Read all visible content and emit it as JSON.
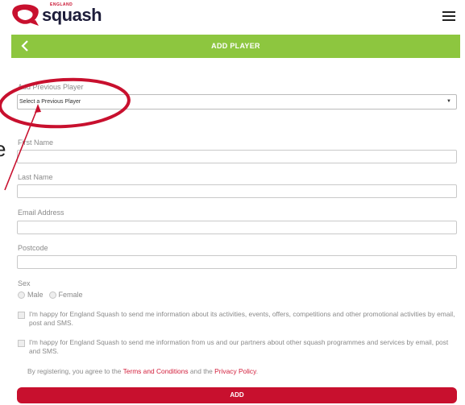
{
  "brand": {
    "name": "squash",
    "tagline": "ENGLAND"
  },
  "title_bar": {
    "label": "ADD PLAYER"
  },
  "form": {
    "previous_player": {
      "label": "Add Previous Player",
      "selected": "Select a Previous Player"
    },
    "first_name": {
      "label": "First Name"
    },
    "last_name": {
      "label": "Last Name"
    },
    "email": {
      "label": "Email Address"
    },
    "postcode": {
      "label": "Postcode"
    },
    "sex": {
      "label": "Sex",
      "options": [
        "Male",
        "Female"
      ]
    },
    "consent_1": "I'm happy for England Squash to send me information about its activities, events, offers, competitions and other promotional activities by email, post and SMS.",
    "consent_2": "I'm happy for England Squash to send me information from us and our partners about other squash programmes and services by email, post and SMS.",
    "legal": {
      "prefix": "By registering, you agree to the ",
      "terms": "Terms and Conditions",
      "middle": " and the ",
      "privacy": "Privacy Policy",
      "suffix": "."
    },
    "submit": "ADD"
  },
  "annotation": {
    "stray_text": "e"
  },
  "colors": {
    "accent_green": "#8dc63f",
    "brand_red": "#c8102e",
    "annotation_red": "#c8102e"
  }
}
